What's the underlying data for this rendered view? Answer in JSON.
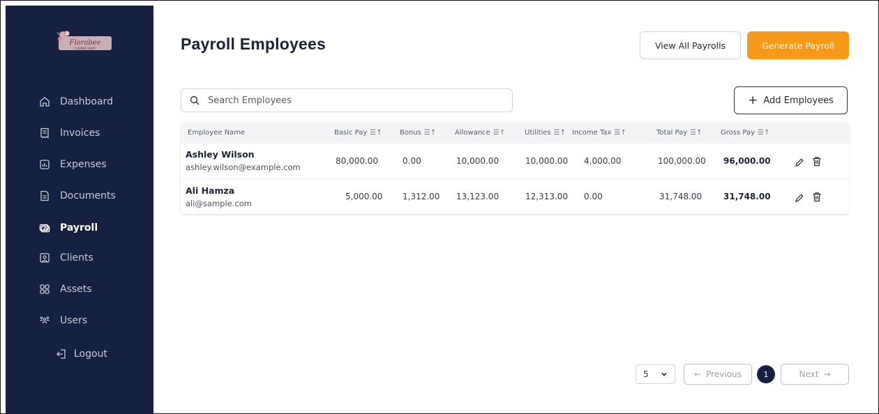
{
  "logo": {
    "text": "Florabee",
    "subtext": "FLOWER SHOP"
  },
  "sidebar": {
    "items": [
      {
        "label": "Dashboard",
        "icon": "home-icon"
      },
      {
        "label": "Invoices",
        "icon": "receipt-icon"
      },
      {
        "label": "Expenses",
        "icon": "chart-file-icon"
      },
      {
        "label": "Documents",
        "icon": "document-icon"
      },
      {
        "label": "Payroll",
        "icon": "money-icon",
        "active": true
      },
      {
        "label": "Clients",
        "icon": "client-icon"
      },
      {
        "label": "Assets",
        "icon": "grid-icon"
      },
      {
        "label": "Users",
        "icon": "users-icon"
      }
    ],
    "logout": "Logout"
  },
  "header": {
    "title": "Payroll Employees",
    "view_all_label": "View All Payrolls",
    "generate_label": "Generate Payroll"
  },
  "search": {
    "placeholder": "Search Employees"
  },
  "add_employees_label": "Add Employees",
  "table": {
    "columns": [
      "Employee Name",
      "Basic Pay",
      "Bonus",
      "Allowance",
      "Utilities",
      "Income Tax",
      "Total Pay",
      "Gross Pay"
    ],
    "rows": [
      {
        "name": "Ashley Wilson",
        "email": "ashley.wilson@example.com",
        "basic": "80,000.00",
        "bonus": "0.00",
        "allowance": "10,000.00",
        "utilities": "10,000.00",
        "tax": "4,000.00",
        "total": "100,000.00",
        "gross": "96,000.00"
      },
      {
        "name": "Ali Hamza",
        "email": "ali@sample.com",
        "basic": "5,000.00",
        "bonus": "1,312.00",
        "allowance": "13,123.00",
        "utilities": "12,313.00",
        "tax": "0.00",
        "total": "31,748.00",
        "gross": "31,748.00"
      }
    ]
  },
  "pagination": {
    "page_size": "5",
    "previous_label": "Previous",
    "current_page": "1",
    "next_label": "Next"
  },
  "colors": {
    "sidebar": "#162040",
    "accent": "#f79a1a"
  }
}
